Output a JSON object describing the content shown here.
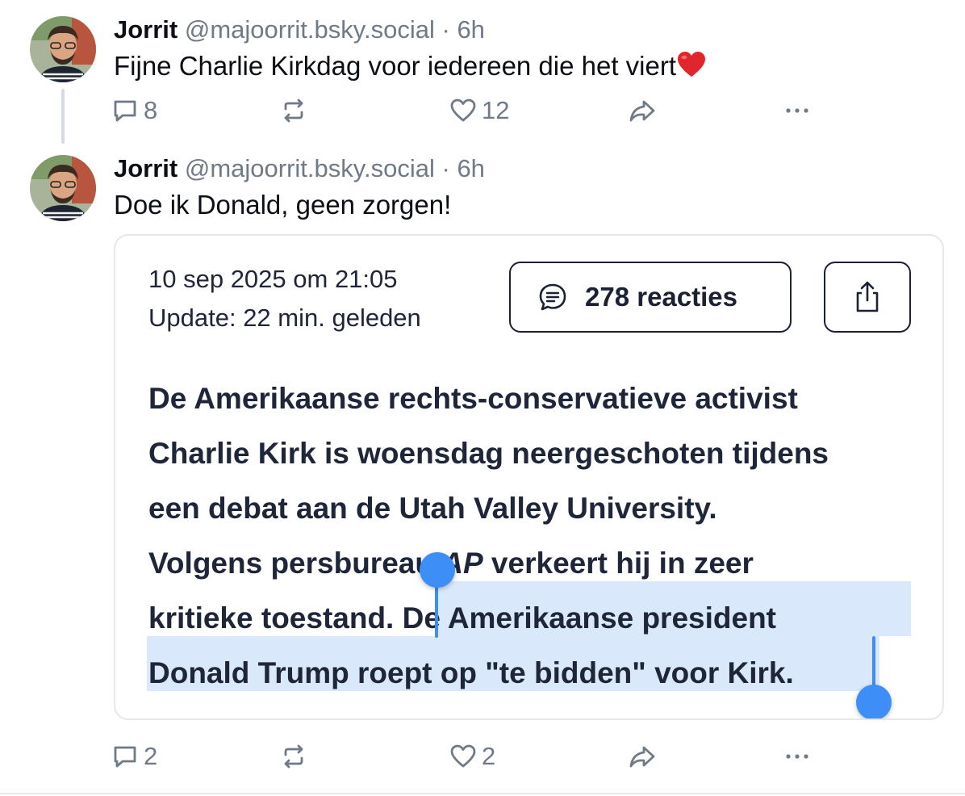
{
  "colors": {
    "text_primary": "#0b0f14",
    "text_muted": "#6f7a86",
    "article_text": "#20263a",
    "selection_highlight": "#d9e8fb",
    "selection_handle": "#3e8ef7",
    "heart": "#e0262d"
  },
  "posts": [
    {
      "author": {
        "name": "Jorrit",
        "handle": "@majoorrit.bsky.social",
        "avatar_icon": "avatar-photo"
      },
      "separator": "·",
      "time": "6h",
      "text": "Fijne Charlie Kirkdag voor iedereen die het viert",
      "emoji": "red-heart-icon",
      "actions": {
        "reply_count": "8",
        "repost_count": "",
        "like_count": "12"
      }
    },
    {
      "author": {
        "name": "Jorrit",
        "handle": "@majoorrit.bsky.social",
        "avatar_icon": "avatar-photo"
      },
      "separator": "·",
      "time": "6h",
      "text": "Doe ik Donald, geen zorgen!",
      "embed": {
        "date_line": "10 sep 2025 om 21:05",
        "update_line": "Update: 22 min. geleden",
        "reactions_label": "278 reacties",
        "share_icon": "share-upload-icon",
        "lines": {
          "l1": "De Amerikaanse rechts-conservatieve activist",
          "l2": "Charlie Kirk is woensdag neergeschoten tijdens",
          "l3": "een debat aan de Utah Valley University.",
          "l4a": "Volgens persbureau ",
          "l4b": "AP",
          "l4c": " verkeert hij in zeer",
          "l5a": "kritieke toestand. ",
          "l5b": "De Amerikaanse president",
          "l6": "Donald Trump roept op \"te bidden\" voor Kirk."
        }
      },
      "actions": {
        "reply_count": "2",
        "repost_count": "",
        "like_count": "2"
      }
    }
  ]
}
